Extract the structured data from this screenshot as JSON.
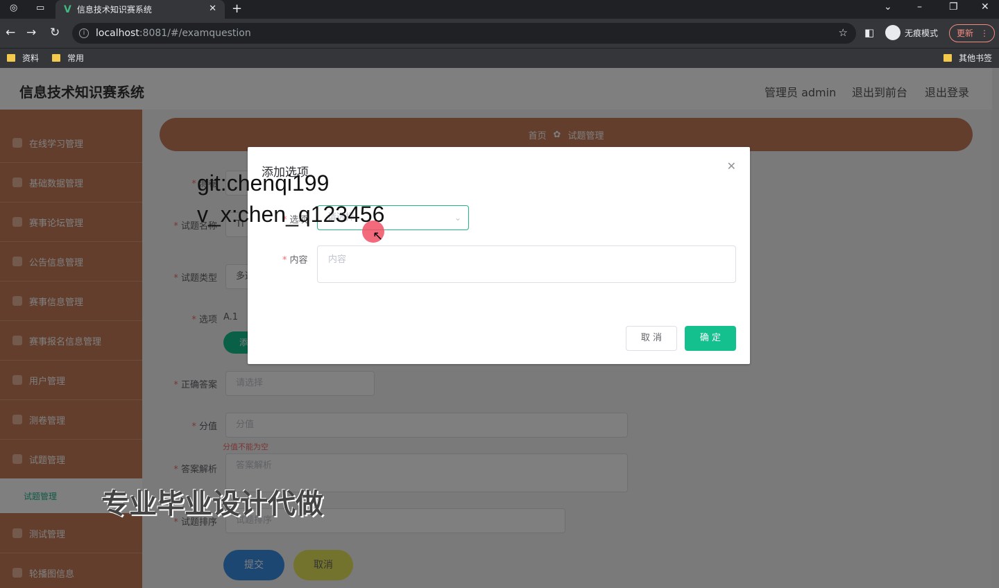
{
  "browser": {
    "tab_title": "信息技术知识赛系统",
    "url_host": "localhost",
    "url_rest": ":8081/#/examquestion",
    "incognito_label": "无痕模式",
    "update_label": "更新",
    "bookmarks": [
      "资料",
      "常用"
    ],
    "other_bookmarks": "其他书签"
  },
  "header": {
    "title": "信息技术知识赛系统",
    "user": "管理员 admin",
    "to_front": "退出到前台",
    "logout": "退出登录"
  },
  "sidebar": {
    "items": [
      "在线学习管理",
      "基础数据管理",
      "赛事论坛管理",
      "公告信息管理",
      "赛事信息管理",
      "赛事报名信息管理",
      "用户管理",
      "测卷管理",
      "试题管理",
      "测试管理",
      "轮播图信息"
    ],
    "active_sub": "试题管理"
  },
  "breadcrumb": {
    "home": "首页",
    "current": "试题管理"
  },
  "form": {
    "paper_label": "测卷",
    "name_label": "试题名称",
    "name_value": "Tl",
    "type_label": "试题类型",
    "type_value": "多选",
    "option_label": "选项",
    "option_value": "A.1",
    "add_btn": "添加",
    "answer_label": "正确答案",
    "answer_placeholder": "请选择",
    "score_label": "分值",
    "score_placeholder": "分值",
    "score_error": "分值不能为空",
    "analysis_label": "答案解析",
    "analysis_placeholder": "答案解析",
    "order_label": "试题排序",
    "order_placeholder": "试题排序",
    "submit": "提交",
    "cancel": "取消"
  },
  "dialog": {
    "title": "添加选项",
    "option_label": "选项",
    "option_placeholder": "请选择",
    "content_label": "内容",
    "content_placeholder": "内容",
    "cancel": "取 消",
    "confirm": "确 定"
  },
  "overlay_text": {
    "line1": "git:chenqi199",
    "line2": "v_x:chen_q123456",
    "banner": "专业毕业设计代做"
  },
  "colors": {
    "accent": "#13c08e",
    "sidebar": "#c77d5a",
    "submit": "#3a8ee6",
    "cancel": "#e6e65a"
  }
}
